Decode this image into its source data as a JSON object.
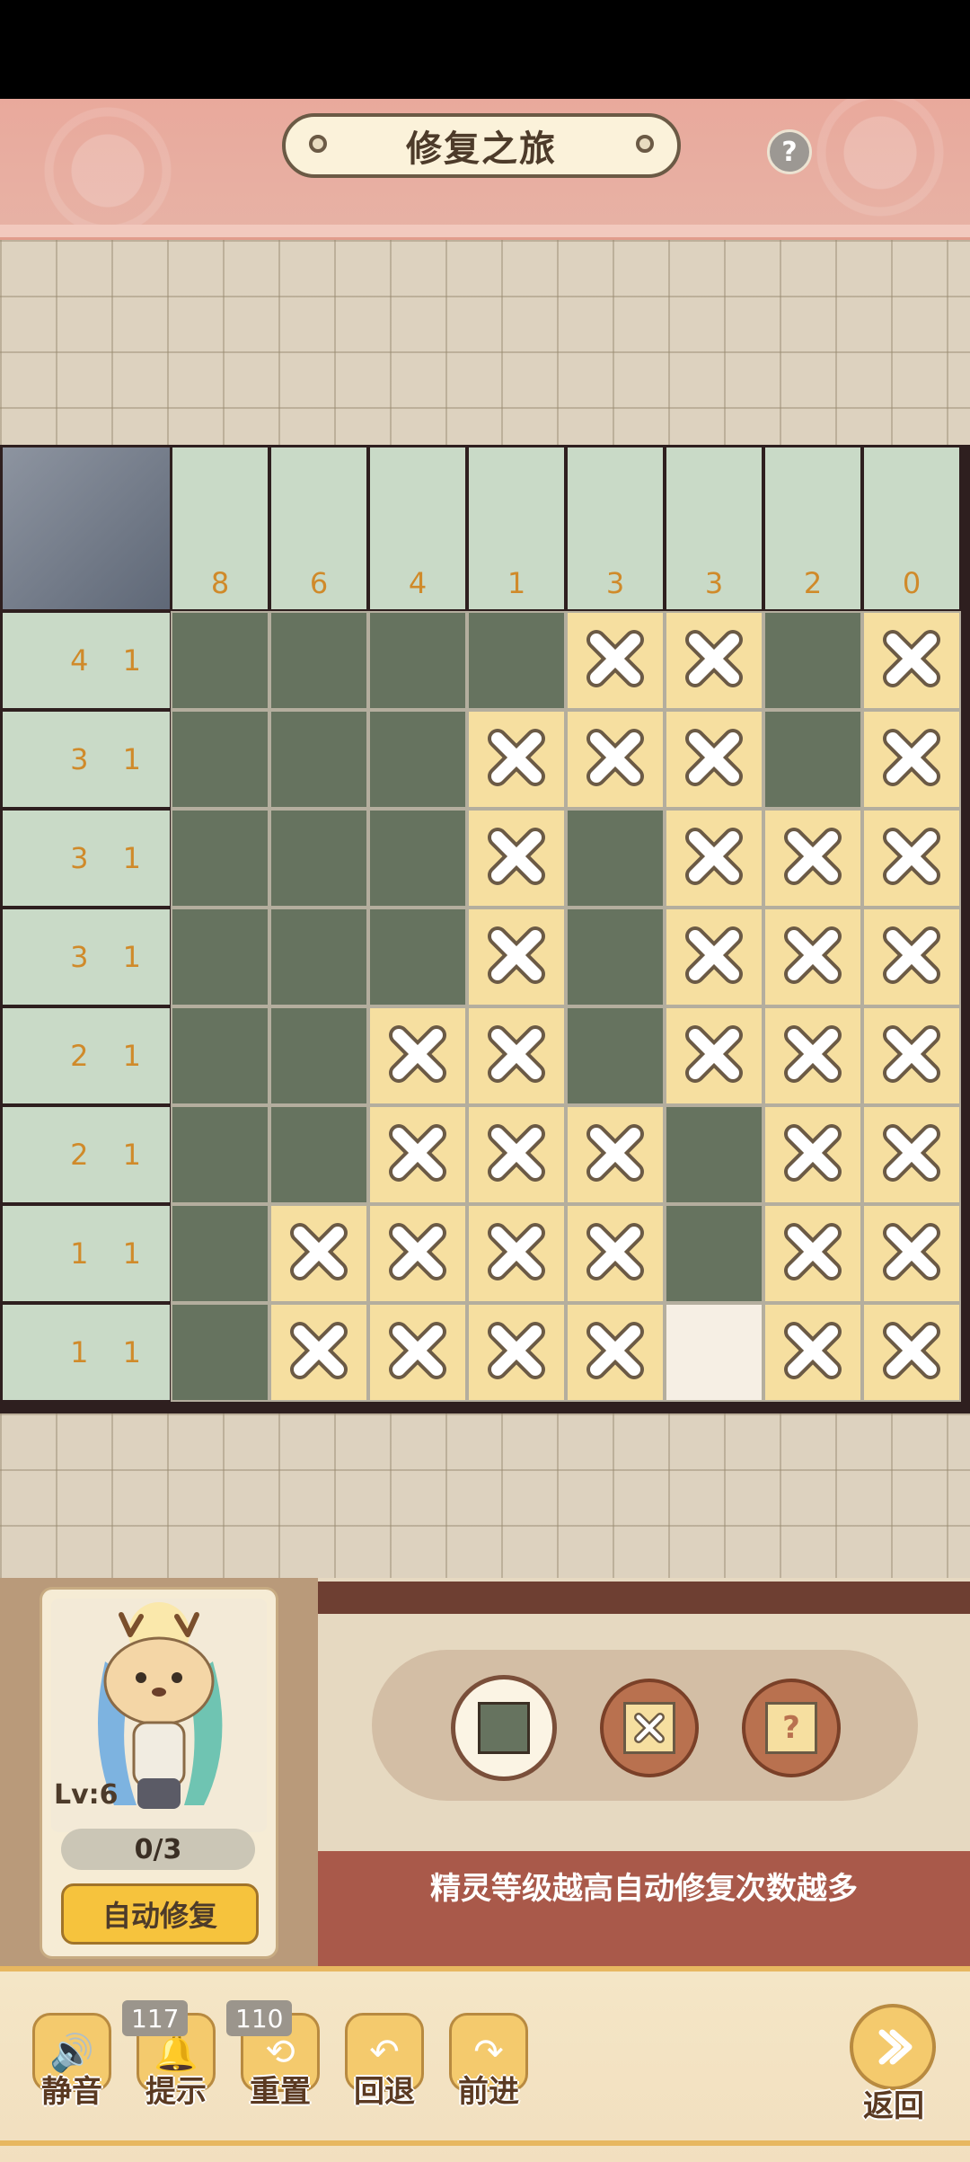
{
  "header": {
    "title": "修复之旅",
    "help_symbol": "?"
  },
  "puzzle": {
    "column_clues": [
      "8",
      "6",
      "4",
      "1",
      "3",
      "3",
      "2",
      "0"
    ],
    "row_clues": [
      "4 1",
      "3 1",
      "3 1",
      "3 1",
      "2 1",
      "2 1",
      "1 1",
      "1 1"
    ],
    "grid": [
      [
        "F",
        "F",
        "F",
        "F",
        "X",
        "X",
        "F",
        "X"
      ],
      [
        "F",
        "F",
        "F",
        "X",
        "X",
        "X",
        "F",
        "X"
      ],
      [
        "F",
        "F",
        "F",
        "X",
        "F",
        "X",
        "X",
        "X"
      ],
      [
        "F",
        "F",
        "F",
        "X",
        "F",
        "X",
        "X",
        "X"
      ],
      [
        "F",
        "F",
        "X",
        "X",
        "F",
        "X",
        "X",
        "X"
      ],
      [
        "F",
        "F",
        "X",
        "X",
        "X",
        "F",
        "X",
        "X"
      ],
      [
        "F",
        "X",
        "X",
        "X",
        "X",
        "F",
        "X",
        "X"
      ],
      [
        "F",
        "X",
        "X",
        "X",
        "X",
        "E",
        "X",
        "X"
      ]
    ],
    "colors": {
      "filled": "#66735f",
      "cross": "#f6dfa0",
      "empty": "#f6efe4",
      "clue_text": "#d08a2a"
    }
  },
  "character": {
    "level": "Lv:6",
    "counter": "0/3",
    "auto_button": "自动修复"
  },
  "tools": {
    "hint_text": "精灵等级越高自动修复次数越多",
    "fill_icon": "filled-square-icon",
    "cross_icon": "cross-icon",
    "question_icon": "question-icon"
  },
  "bottom_bar": {
    "mute": "静音",
    "hint": "提示",
    "hint_count": "117",
    "reset": "重置",
    "reset_count": "110",
    "undo": "回退",
    "redo": "前进",
    "return": "返回"
  }
}
